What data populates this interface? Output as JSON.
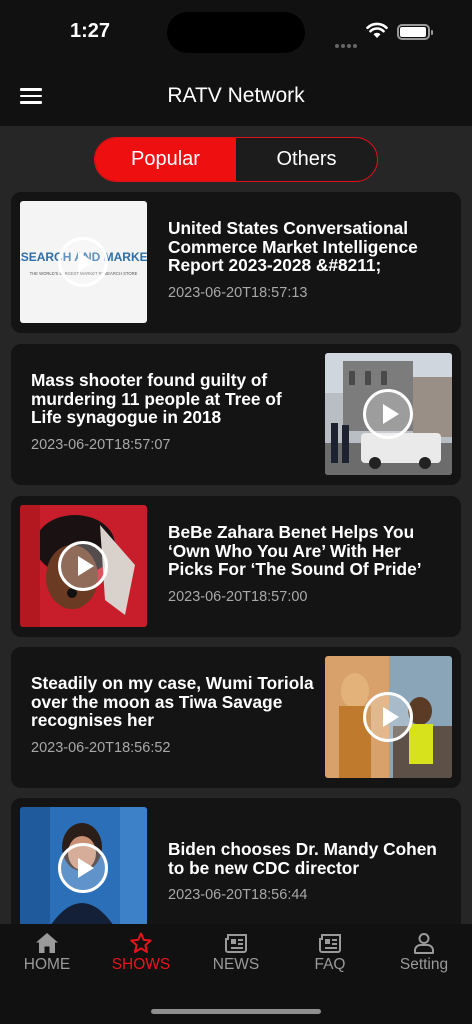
{
  "status": {
    "time": "1:27"
  },
  "header": {
    "title": "RATV Network",
    "menu_icon": "hamburger-icon"
  },
  "segments": [
    {
      "label": "Popular",
      "active": true
    },
    {
      "label": "Others",
      "active": false
    }
  ],
  "feed": [
    {
      "title": "United States Conversational Commerce Market Intelligence Report 2023-2028 &#8211;",
      "date": "2023-06-20T18:57:13",
      "thumb_text_1": "RESEARCH AND MARKETS",
      "thumb_text_2": "THE WORLD'S LARGEST MARKET RESEARCH STORE"
    },
    {
      "title": "Mass shooter found guilty of murdering 11 people at Tree of Life synagogue in 2018",
      "date": "2023-06-20T18:57:07"
    },
    {
      "title": "BeBe Zahara Benet Helps You ‘Own Who You Are’ With Her Picks For ‘The Sound Of Pride’",
      "date": "2023-06-20T18:57:00"
    },
    {
      "title": "Steadily on my case, Wumi Toriola over the moon as Tiwa Savage recognises her",
      "date": "2023-06-20T18:56:52"
    },
    {
      "title": "Biden chooses Dr. Mandy Cohen to be new CDC director",
      "date": "2023-06-20T18:56:44"
    }
  ],
  "tabs": [
    {
      "label": "HOME",
      "icon": "home-icon",
      "active": false
    },
    {
      "label": "SHOWS",
      "icon": "star-icon",
      "active": true
    },
    {
      "label": "NEWS",
      "icon": "newspaper-icon",
      "active": false
    },
    {
      "label": "FAQ",
      "icon": "newspaper-icon",
      "active": false
    },
    {
      "label": "Setting",
      "icon": "person-icon",
      "active": false
    }
  ],
  "colors": {
    "accent": "#ee0f10",
    "background": "#262626",
    "card": "#141414",
    "bar": "#111111",
    "muted": "#9a9a9a"
  }
}
